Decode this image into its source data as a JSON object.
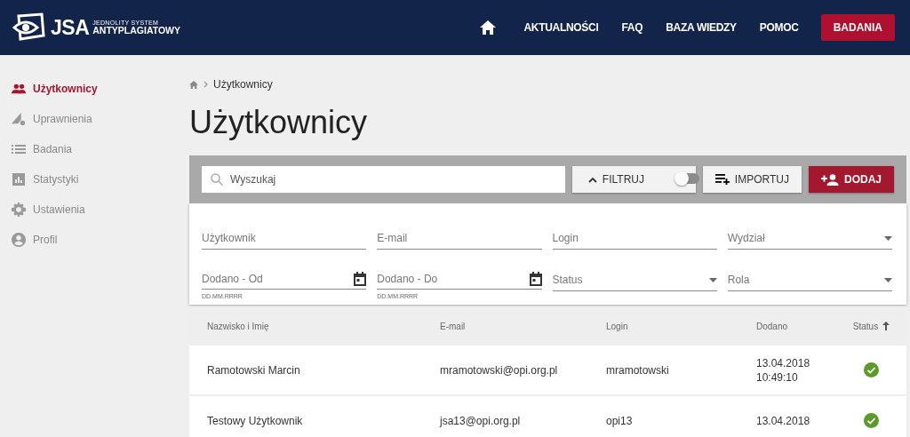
{
  "header": {
    "logo_mark": "JSA",
    "logo_line1": "JEDNOLITY SYSTEM",
    "logo_line2": "ANTYPLAGIATOWY",
    "nav": [
      {
        "label": "AKTUALNOŚCI",
        "kind": "link"
      },
      {
        "label": "FAQ",
        "kind": "link"
      },
      {
        "label": "BAZA WIEDZY",
        "kind": "link"
      },
      {
        "label": "POMOC",
        "kind": "link"
      },
      {
        "label": "BADANIA",
        "kind": "primary"
      }
    ]
  },
  "sidebar": {
    "items": [
      {
        "label": "Użytkownicy",
        "selected": true
      },
      {
        "label": "Uprawnienia",
        "selected": false
      },
      {
        "label": "Badania",
        "selected": false
      },
      {
        "label": "Statystyki",
        "selected": false
      },
      {
        "label": "Ustawienia",
        "selected": false
      },
      {
        "label": "Profil",
        "selected": false
      }
    ]
  },
  "breadcrumb": [
    "Użytkownicy"
  ],
  "page_title": "Użytkownicy",
  "toolbar": {
    "search": {
      "placeholder": "Wyszukaj"
    },
    "filter": {
      "label": "FILTRUJ",
      "expanded": true,
      "on": false
    },
    "import_label": "IMPORTUJ",
    "add_label": "DODAJ"
  },
  "filters": [
    {
      "label": "Użytkownik",
      "kind": "text"
    },
    {
      "label": "E-mail",
      "kind": "text"
    },
    {
      "label": "Login",
      "kind": "text"
    },
    {
      "label": "Wydział",
      "kind": "select"
    },
    {
      "label": "Dodano - Od",
      "kind": "date",
      "hint": "DD.MM.RRRR"
    },
    {
      "label": "Dodano - Do",
      "kind": "date",
      "hint": "DD.MM.RRRR"
    },
    {
      "label": "Status",
      "kind": "select"
    },
    {
      "label": "Rola",
      "kind": "select"
    }
  ],
  "table": {
    "columns": [
      {
        "label": "Nazwisko i Imię",
        "sorted": false
      },
      {
        "label": "E-mail",
        "sorted": false
      },
      {
        "label": "Login",
        "sorted": false
      },
      {
        "label": "Dodano",
        "sorted": false
      },
      {
        "label": "Status",
        "sorted": true
      }
    ],
    "rows": [
      {
        "name": "Ramotowski Marcin",
        "email": "mramotowski@opi.org.pl",
        "login": "mramotowski",
        "added": [
          "13.04.2018",
          "10:49:10"
        ],
        "active": true
      },
      {
        "name": "Testowy Użytkownik",
        "email": "jsa13@opi.org.pl",
        "login": "opi13",
        "added": [
          "13.04.2018"
        ],
        "active": true
      }
    ]
  }
}
